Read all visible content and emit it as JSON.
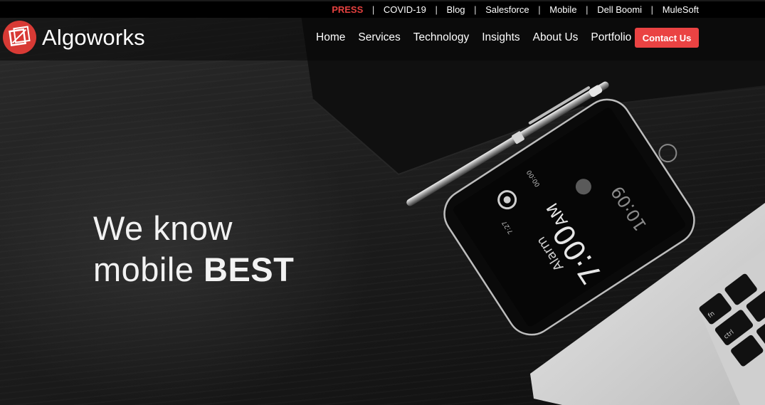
{
  "topbar": {
    "press": "PRESS",
    "links": [
      "COVID-19",
      "Blog",
      "Salesforce",
      "Mobile",
      "Dell Boomi",
      "MuleSoft"
    ],
    "separator": "|"
  },
  "brand": {
    "name": "Algoworks"
  },
  "nav": {
    "items": [
      "Home",
      "Services",
      "Technology",
      "Insights",
      "About Us",
      "Portfolio"
    ],
    "cta": "Contact Us"
  },
  "hero": {
    "line1": "We know",
    "line2_regular": "mobile ",
    "line2_bold": "BEST",
    "phone": {
      "alarm_label": "Alarm",
      "alarm_time": "7:00",
      "alarm_period": "AM",
      "clock": "10:09",
      "sunrise": "7:27",
      "timer": "00:00"
    },
    "keyboard_keys": [
      "fn",
      "ctrl"
    ]
  },
  "colors": {
    "accent": "#ea4343",
    "press": "#e4413f",
    "nav_background": "#000000"
  },
  "icons": [
    "algoworks-logo-icon",
    "alarm-ring-icon",
    "sunrise-icon",
    "timer-icon",
    "home-button-icon"
  ]
}
